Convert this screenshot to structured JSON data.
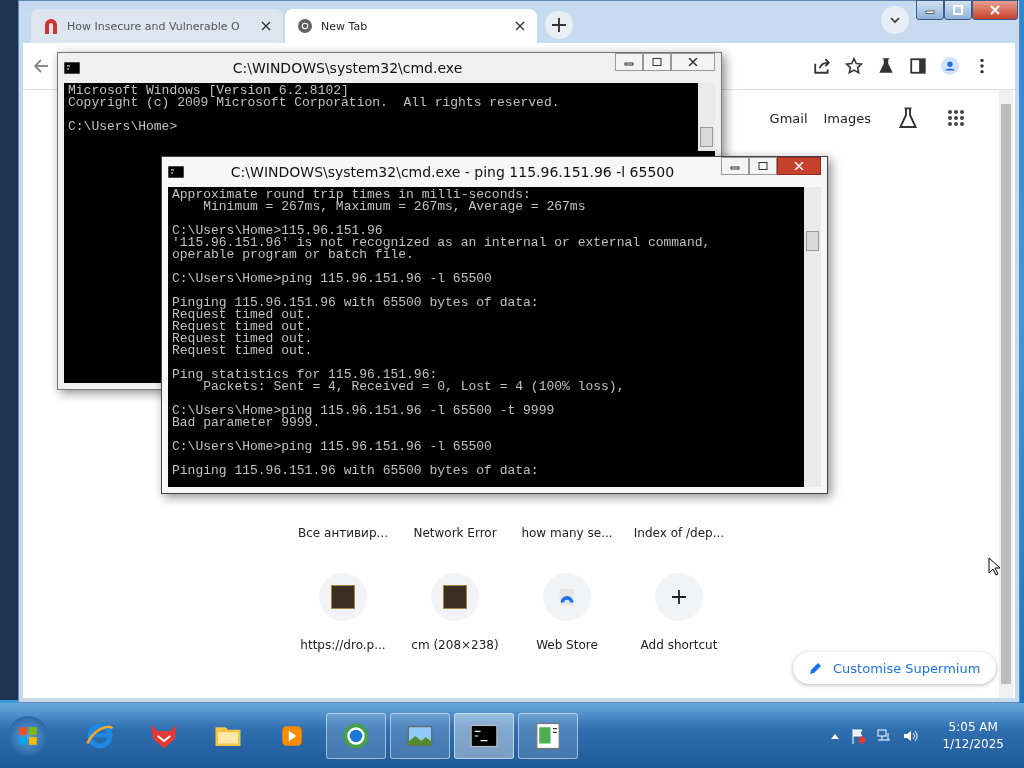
{
  "browser": {
    "tabs": [
      {
        "title": "How Insecure and Vulnerable O",
        "kind": "site",
        "selected": false
      },
      {
        "title": "New Tab",
        "kind": "newtab",
        "selected": true
      }
    ],
    "links": [
      "Gmail",
      "Images"
    ],
    "shortcuts": [
      {
        "label": "Все антивир...",
        "kind": "covered"
      },
      {
        "label": "Network Error",
        "kind": "covered"
      },
      {
        "label": "how many se...",
        "kind": "covered"
      },
      {
        "label": "Index of /dep...",
        "kind": "covered"
      },
      {
        "label": "https://dro.p...",
        "kind": "site"
      },
      {
        "label": "cm (208×238)",
        "kind": "site"
      },
      {
        "label": "Web Store",
        "kind": "store"
      },
      {
        "label": "Add shortcut",
        "kind": "add"
      }
    ],
    "customise": "Customise Supermium"
  },
  "consoles": [
    {
      "title": "C:\\WINDOWS\\system32\\cmd.exe",
      "active": false,
      "blocks": [
        [
          "Microsoft Windows [Version 6.2.8102]",
          "Copyright (c) 2009 Microsoft Corporation.  All rights reserved."
        ],
        [
          "C:\\Users\\Home>"
        ]
      ]
    },
    {
      "title": "C:\\WINDOWS\\system32\\cmd.exe - ping  115.96.151.96 -l 65500",
      "active": true,
      "blocks": [
        [
          "Approximate round trip times in milli-seconds:",
          "    Minimum = 267ms, Maximum = 267ms, Average = 267ms"
        ],
        [
          "C:\\Users\\Home>115.96.151.96",
          "'115.96.151.96' is not recognized as an internal or external command,",
          "operable program or batch file."
        ],
        [
          "C:\\Users\\Home>ping 115.96.151.96 -l 65500"
        ],
        [
          "Pinging 115.96.151.96 with 65500 bytes of data:",
          "Request timed out.",
          "Request timed out.",
          "Request timed out.",
          "Request timed out."
        ],
        [
          "Ping statistics for 115.96.151.96:",
          "    Packets: Sent = 4, Received = 0, Lost = 4 (100% loss),"
        ],
        [
          "C:\\Users\\Home>ping 115.96.151.96 -l 65500 -t 9999",
          "Bad parameter 9999."
        ],
        [
          "C:\\Users\\Home>ping 115.96.151.96 -l 65500"
        ],
        [
          "Pinging 115.96.151.96 with 65500 bytes of data:"
        ]
      ]
    }
  ],
  "taskbar": {
    "items": [
      {
        "kind": "ie",
        "open": false,
        "selected": false
      },
      {
        "kind": "fox",
        "open": false,
        "selected": false
      },
      {
        "kind": "folder",
        "open": false,
        "selected": false
      },
      {
        "kind": "media",
        "open": false,
        "selected": false
      },
      {
        "kind": "globe",
        "open": true,
        "selected": false
      },
      {
        "kind": "picture",
        "open": true,
        "selected": false
      },
      {
        "kind": "console",
        "open": true,
        "selected": true
      },
      {
        "kind": "document",
        "open": true,
        "selected": false
      }
    ],
    "time": "5:05 AM",
    "date": "1/12/2025"
  }
}
